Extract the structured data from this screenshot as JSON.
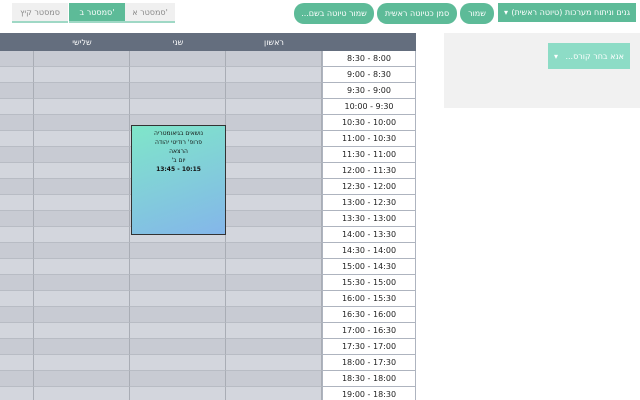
{
  "semesters": [
    {
      "label": "סמסטר קיץ",
      "active": false
    },
    {
      "label": "סמסטר ב'",
      "active": true
    },
    {
      "label": "סמסטר א'",
      "active": false
    }
  ],
  "toolbar": {
    "save_as": "שמור טיוטה בשם...",
    "mark_main": "סמן כטיוטה ראשית",
    "save": "שמור",
    "draft_select": "גנים וניתוח מערכות (טיוטה ראשית)"
  },
  "course_select": {
    "placeholder": "אנא בחר קורס..."
  },
  "days": [
    "ראשון",
    "שני",
    "שלישי"
  ],
  "times": [
    "8:30 - 8:00",
    "9:00 - 8:30",
    "9:30 - 9:00",
    "10:00 - 9:30",
    "10:30 - 10:00",
    "11:00 - 10:30",
    "11:30 - 11:00",
    "12:00 - 11:30",
    "12:30 - 12:00",
    "13:00 - 12:30",
    "13:30 - 13:00",
    "14:00 - 13:30",
    "14:30 - 14:00",
    "15:00 - 14:30",
    "15:30 - 15:00",
    "16:00 - 15:30",
    "16:30 - 16:00",
    "17:00 - 16:30",
    "17:30 - 17:00",
    "18:00 - 17:30",
    "18:30 - 18:00",
    "19:00 - 18:30"
  ],
  "course": {
    "name": "נושאים בגיאומטריה",
    "lecturer": "פרופ' רודיטי יהודה",
    "type": "הרצאה",
    "day": "יום ב'",
    "time": "13:45 - 10:15"
  }
}
